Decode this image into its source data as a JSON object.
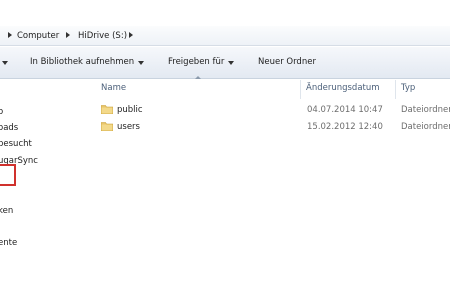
{
  "address": {
    "crumbs": [
      "Computer",
      "HiDrive (S:)"
    ]
  },
  "toolbar": {
    "library_label": "In Bibliothek aufnehmen",
    "share_label": "Freigeben für",
    "new_folder_label": "Neuer Ordner"
  },
  "nav": {
    "items": [
      "o",
      "oads",
      "besucht",
      "ugarSync",
      "ken",
      "ente"
    ]
  },
  "columns": {
    "name": "Name",
    "date": "Änderungsdatum",
    "type": "Typ"
  },
  "files": [
    {
      "name": "public",
      "date": "04.07.2014 10:47",
      "type": "Dateiordner"
    },
    {
      "name": "users",
      "date": "15.02.2012 12:40",
      "type": "Dateiordner"
    }
  ],
  "colors": {
    "highlight": "#d0312d",
    "folder": "#e8c56a"
  }
}
